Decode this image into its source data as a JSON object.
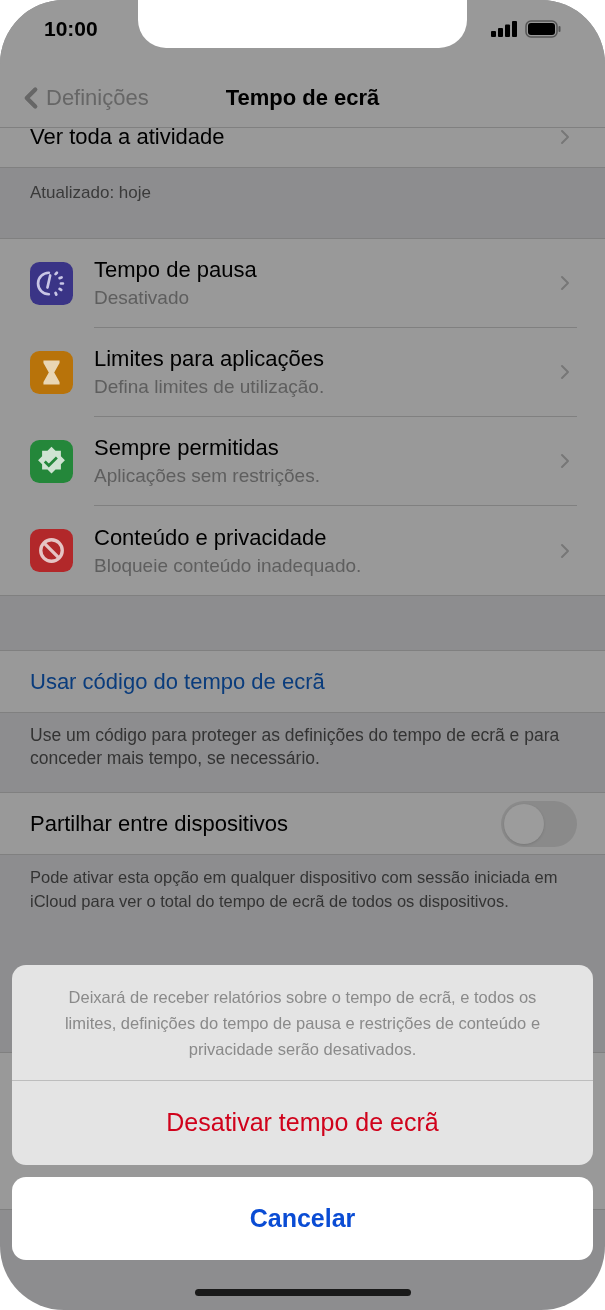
{
  "status_bar": {
    "time": "10:00"
  },
  "nav": {
    "back": "Definições",
    "title": "Tempo de ecrã"
  },
  "activity_row": {
    "label": "Ver toda a atividade"
  },
  "updated": "Atualizado: hoje",
  "items": [
    {
      "kind": "downtime",
      "title": "Tempo de pausa",
      "subtitle": "Desativado"
    },
    {
      "kind": "limits",
      "title": "Limites para aplicações",
      "subtitle": "Defina limites de utilização."
    },
    {
      "kind": "allowed",
      "title": "Sempre permitidas",
      "subtitle": "Aplicações sem restrições."
    },
    {
      "kind": "restrictions",
      "title": "Conteúdo e privacidade",
      "subtitle": "Bloqueie conteúdo inadequado."
    }
  ],
  "passcode": {
    "link": "Usar código do tempo de ecrã",
    "footer": "Use um código para proteger as definições do tempo de ecrã e para conceder mais tempo, se necessário."
  },
  "share": {
    "label": "Partilhar entre dispositivos",
    "on": false,
    "footer": "Pode ativar esta opção em qualquer dispositivo com sessão iniciada em iCloud para ver o total do tempo de ecrã de todos os dispositivos."
  },
  "action_sheet": {
    "message": "Deixará de receber relatórios sobre o tempo de ecrã, e todos os limites, definições do tempo de pausa e restrições de conteúdo e privacidade serão desativados.",
    "destructive": "Desativar tempo de ecrã",
    "cancel": "Cancelar"
  }
}
